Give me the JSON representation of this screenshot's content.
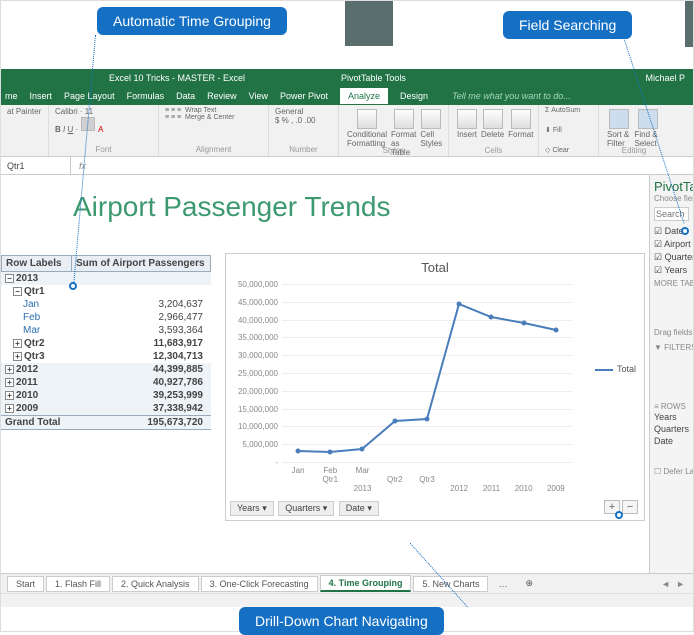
{
  "callouts": {
    "timeGrouping": "Automatic Time Grouping",
    "fieldSearching": "Field Searching",
    "drillDown": "Drill-Down Chart Navigating"
  },
  "titlebar": {
    "document": "Excel 10 Tricks - MASTER - Excel",
    "contextTools": "PivotTable Tools",
    "user": "Michael P"
  },
  "ribbonTabs": [
    "me",
    "Insert",
    "Page Layout",
    "Formulas",
    "Data",
    "Review",
    "View",
    "Power Pivot",
    "Analyze",
    "Design"
  ],
  "tellMe": "Tell me what you want to do...",
  "ribbonGroups": {
    "clipboard": "at Painter",
    "font": "Font",
    "fontName": "Calibri",
    "fontSize": "11",
    "alignment": "Alignment",
    "wrap": "Wrap Text",
    "merge": "Merge & Center",
    "number": "Number",
    "numberFormat": "General",
    "styles": "Styles",
    "condFmt": "Conditional Formatting",
    "fmtTable": "Format as Table",
    "cellStyles": "Cell Styles",
    "cells": "Cells",
    "insert": "Insert",
    "delete": "Delete",
    "format": "Format",
    "editing": "Editing",
    "autosum": "AutoSum",
    "fill": "Fill",
    "clear": "Clear",
    "sort": "Sort & Filter",
    "find": "Find & Select"
  },
  "nameBox": "Qtr1",
  "heading": "Airport Passenger Trends",
  "pivot": {
    "hdrRow": "Row Labels",
    "hdrVal": "Sum of Airport Passengers",
    "y2013": "2013",
    "q1": "Qtr1",
    "jan": "Jan",
    "janV": "3,204,637",
    "feb": "Feb",
    "febV": "2,966,477",
    "mar": "Mar",
    "marV": "3,593,364",
    "q2": "Qtr2",
    "q2V": "11,683,917",
    "q3": "Qtr3",
    "q3V": "12,304,713",
    "y2012": "2012",
    "y2012V": "44,399,885",
    "y2011": "2011",
    "y2011V": "40,927,786",
    "y2010": "2010",
    "y2010V": "39,253,999",
    "y2009": "2009",
    "y2009V": "37,338,942",
    "grand": "Grand Total",
    "grandV": "195,673,720"
  },
  "chart": {
    "title": "Total",
    "legend": "Total",
    "filters": {
      "years": "Years",
      "quarters": "Quarters",
      "date": "Date"
    },
    "drillPlus": "+",
    "drillMinus": "−"
  },
  "chart_data": {
    "type": "line",
    "title": "Total",
    "ylabel": "",
    "ylim": [
      0,
      50000000
    ],
    "yticks": [
      0,
      5000000,
      10000000,
      15000000,
      20000000,
      25000000,
      30000000,
      35000000,
      40000000,
      45000000,
      50000000
    ],
    "categories": [
      "Jan 2013 Qtr1",
      "Feb 2013 Qtr1",
      "Mar 2013 Qtr1",
      "Qtr2 2013",
      "Qtr3 2013",
      "2012",
      "2011",
      "2010",
      "2009"
    ],
    "series": [
      {
        "name": "Total",
        "values": [
          3204637,
          2966477,
          3593364,
          11683917,
          12304713,
          44399885,
          40927786,
          39253999,
          37338942
        ]
      }
    ]
  },
  "fieldPane": {
    "title": "PivotTable",
    "choose": "Choose fields to",
    "searchPlaceholder": "Search",
    "fields": [
      "Date",
      "Airport Passe",
      "Quarters",
      "Years"
    ],
    "more": "MORE TABLES...",
    "drag": "Drag fields betw",
    "filters": "FILTERS",
    "rows": "ROWS",
    "rowItems": [
      "Years",
      "Quarters",
      "Date"
    ],
    "defer": "Defer Layout"
  },
  "sheetTabs": [
    "Start",
    "1. Flash Fill",
    "2. Quick Analysis",
    "3. One-Click Forecasting",
    "4. Time Grouping",
    "5. New Charts"
  ],
  "tabMore": "…",
  "tabAdd": "⊕"
}
